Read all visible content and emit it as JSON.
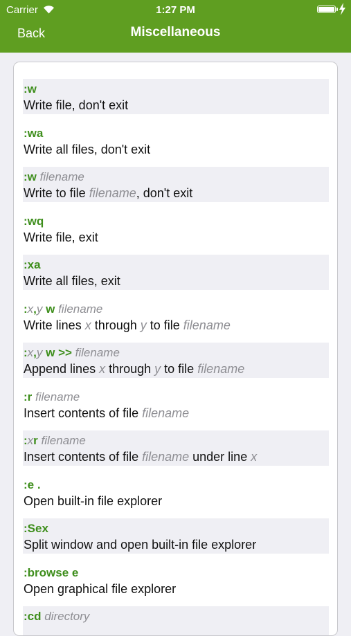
{
  "status_bar": {
    "carrier": "Carrier",
    "time": "1:27 PM"
  },
  "nav": {
    "back_label": "Back",
    "title": "Miscellaneous"
  },
  "colors": {
    "header": "#5f9e21",
    "command": "#3e8e1c",
    "param": "#8e8e93",
    "shaded_row": "#efeff4"
  },
  "entries": [
    {
      "cmd": [
        [
          "k",
          ":w"
        ]
      ],
      "desc": [
        [
          "t",
          "Write file, don't exit"
        ]
      ]
    },
    {
      "cmd": [
        [
          "k",
          ":wa"
        ]
      ],
      "desc": [
        [
          "t",
          "Write all files, don't exit"
        ]
      ]
    },
    {
      "cmd": [
        [
          "k",
          ":w "
        ],
        [
          "p",
          "filename"
        ]
      ],
      "desc": [
        [
          "t",
          "Write to file "
        ],
        [
          "p",
          "filename"
        ],
        [
          "t",
          ", don't exit"
        ]
      ]
    },
    {
      "cmd": [
        [
          "k",
          ":wq"
        ]
      ],
      "desc": [
        [
          "t",
          "Write file, exit"
        ]
      ]
    },
    {
      "cmd": [
        [
          "k",
          ":xa"
        ]
      ],
      "desc": [
        [
          "t",
          "Write all files, exit"
        ]
      ]
    },
    {
      "cmd": [
        [
          "k",
          ":"
        ],
        [
          "p",
          "x"
        ],
        [
          "k",
          ","
        ],
        [
          "p",
          "y"
        ],
        [
          "k",
          " w "
        ],
        [
          "p",
          "filename"
        ]
      ],
      "desc": [
        [
          "t",
          "Write lines "
        ],
        [
          "p",
          "x"
        ],
        [
          "t",
          " through "
        ],
        [
          "p",
          "y"
        ],
        [
          "t",
          " to file "
        ],
        [
          "p",
          "filename"
        ]
      ]
    },
    {
      "cmd": [
        [
          "k",
          ":"
        ],
        [
          "p",
          "x"
        ],
        [
          "k",
          ","
        ],
        [
          "p",
          "y"
        ],
        [
          "k",
          " w >> "
        ],
        [
          "p",
          "filename"
        ]
      ],
      "desc": [
        [
          "t",
          "Append lines "
        ],
        [
          "p",
          "x"
        ],
        [
          "t",
          " through "
        ],
        [
          "p",
          "y"
        ],
        [
          "t",
          " to file "
        ],
        [
          "p",
          "filename"
        ]
      ]
    },
    {
      "cmd": [
        [
          "k",
          ":r "
        ],
        [
          "p",
          "filename"
        ]
      ],
      "desc": [
        [
          "t",
          "Insert contents of file "
        ],
        [
          "p",
          "filename"
        ]
      ]
    },
    {
      "cmd": [
        [
          "k",
          ":"
        ],
        [
          "p",
          "x"
        ],
        [
          "k",
          "r "
        ],
        [
          "p",
          "filename"
        ]
      ],
      "desc": [
        [
          "t",
          "Insert contents of file "
        ],
        [
          "p",
          "filename"
        ],
        [
          "t",
          " under line "
        ],
        [
          "p",
          "x"
        ]
      ]
    },
    {
      "cmd": [
        [
          "k",
          ":e ."
        ]
      ],
      "desc": [
        [
          "t",
          "Open built-in file explorer"
        ]
      ]
    },
    {
      "cmd": [
        [
          "k",
          ":Sex"
        ]
      ],
      "desc": [
        [
          "t",
          "Split window and open built-in file explorer"
        ]
      ]
    },
    {
      "cmd": [
        [
          "k",
          ":browse e"
        ]
      ],
      "desc": [
        [
          "t",
          "Open graphical file explorer"
        ]
      ]
    },
    {
      "cmd": [
        [
          "k",
          ":cd "
        ],
        [
          "p",
          "directory"
        ]
      ],
      "desc": []
    }
  ]
}
